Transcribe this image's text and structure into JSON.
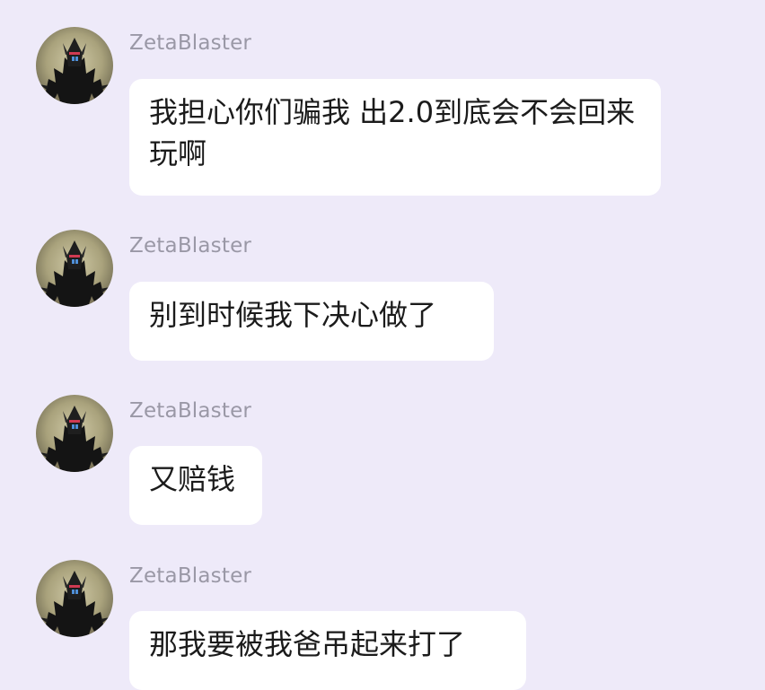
{
  "messages": [
    {
      "sender": "ZetaBlaster",
      "text": "我担心你们骗我 出2.0到底会不会回来玩啊"
    },
    {
      "sender": "ZetaBlaster",
      "text": "别到时候我下决心做了"
    },
    {
      "sender": "ZetaBlaster",
      "text": "又赔钱"
    },
    {
      "sender": "ZetaBlaster",
      "text": "那我要被我爸吊起来打了"
    }
  ]
}
